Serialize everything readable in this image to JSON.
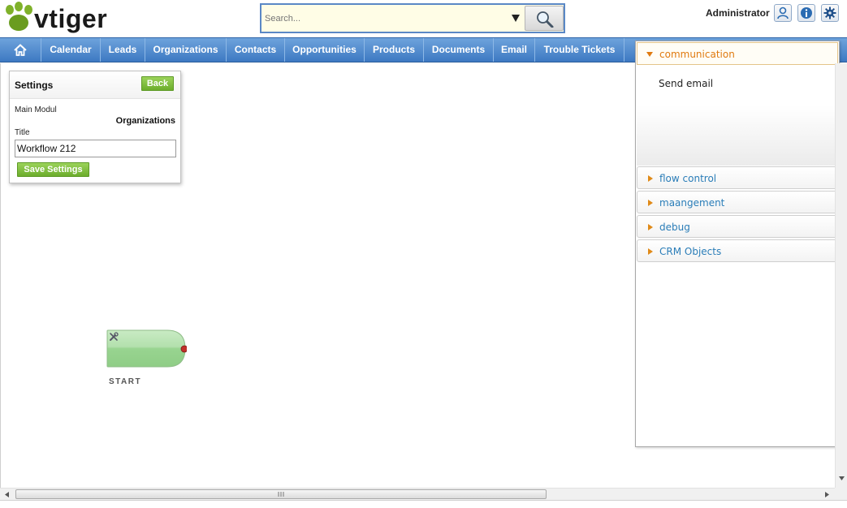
{
  "header": {
    "logo_text": "vtiger",
    "search_placeholder": "Search...",
    "user_name": "Administrator",
    "icons": [
      "user-icon",
      "info-icon",
      "gear-icon"
    ]
  },
  "nav": {
    "home_icon": "home-icon",
    "items": [
      "Calendar",
      "Leads",
      "Organizations",
      "Contacts",
      "Opportunities",
      "Products",
      "Documents",
      "Email",
      "Trouble Tickets"
    ]
  },
  "settings": {
    "title": "Settings",
    "back_label": "Back",
    "main_module_label": "Main Modul",
    "main_module_value": "Organizations",
    "title_label": "Title",
    "title_value": "Workflow 212",
    "save_label": "Save Settings"
  },
  "canvas": {
    "start_label": "START"
  },
  "tasks_panel": {
    "open_group": {
      "title": "communication",
      "items": [
        "Send email"
      ]
    },
    "groups": [
      "flow control",
      "maangement",
      "debug",
      "CRM Objects"
    ]
  },
  "colors": {
    "nav_blue": "#3d79c2",
    "accent_green": "#6cad2c",
    "open_group_orange": "#e07a10",
    "group_link_blue": "#2a7db8"
  }
}
